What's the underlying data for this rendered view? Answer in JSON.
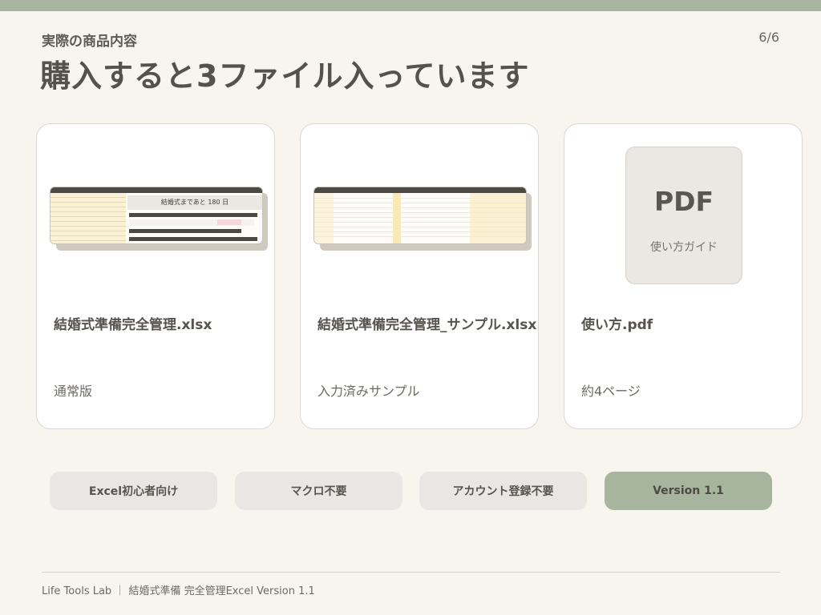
{
  "header": {
    "subtitle": "実際の商品内容",
    "page_indicator": "6/6",
    "title": "購入すると3ファイル入っています"
  },
  "files": [
    {
      "name": "結婚式準備完全管理.xlsx",
      "description": "通常版",
      "preview": "spreadsheet",
      "preview_banner": "結婚式まであと 180 日"
    },
    {
      "name": "結婚式準備完全管理_サンプル.xlsx",
      "description": "入力済みサンプル",
      "preview": "spreadsheet"
    },
    {
      "name": "使い方.pdf",
      "description": "約4ページ",
      "preview": "pdf",
      "preview_label": "PDF",
      "preview_caption": "使い方ガイド"
    }
  ],
  "features": [
    {
      "label": "Excel初心者向け"
    },
    {
      "label": "マクロ不要"
    },
    {
      "label": "アカウント登録不要"
    },
    {
      "label": "Version 1.1",
      "highlighted": true
    }
  ],
  "footer": {
    "text": "Life Tools Lab ｜ 結婚式準備 完全管理Excel  Version 1.1"
  },
  "colors": {
    "accent": "#a8b59e",
    "background": "#f8f5ef",
    "card": "#ffffff",
    "text": "#57534e"
  }
}
